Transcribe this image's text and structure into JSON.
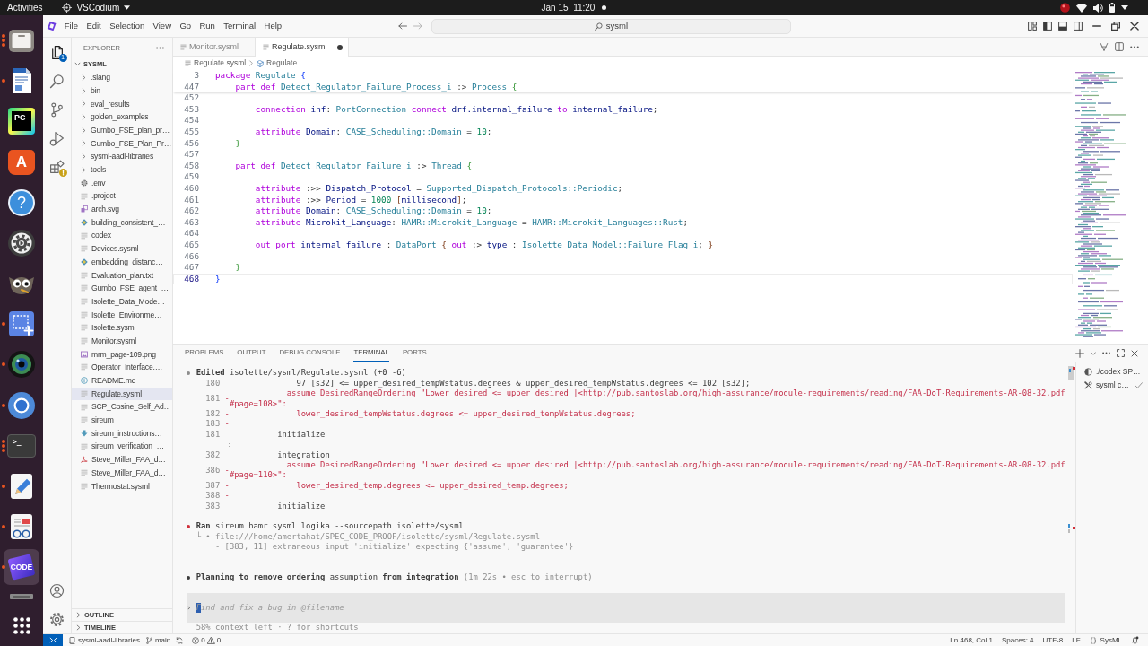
{
  "top_bar": {
    "activities": "Activities",
    "app_menu": "VSCodium",
    "clock": "Jan 15  11:20"
  },
  "dock": [
    {
      "kind": "files",
      "running": true,
      "multiple_windows": true,
      "focused": false
    },
    {
      "kind": "writer",
      "running": true,
      "multiple_windows": false,
      "focused": false
    },
    {
      "kind": "pycharm",
      "label": "PC",
      "running": false,
      "focused": false
    },
    {
      "kind": "store",
      "label": "A",
      "running": false,
      "focused": false
    },
    {
      "kind": "help",
      "label": "?",
      "running": false,
      "focused": false
    },
    {
      "kind": "settings",
      "running": false,
      "focused": false
    },
    {
      "kind": "gimp",
      "running": false,
      "focused": false
    },
    {
      "kind": "screenshot",
      "running": true,
      "multiple_windows": false,
      "focused": false
    },
    {
      "kind": "lens",
      "running": true,
      "multiple_windows": false,
      "focused": false
    },
    {
      "kind": "browser",
      "running": true,
      "multiple_windows": false,
      "focused": false
    },
    {
      "kind": "terminal",
      "label": ">_",
      "running": true,
      "multiple_windows": true,
      "focused": false
    },
    {
      "kind": "editor",
      "running": true,
      "multiple_windows": false,
      "focused": false
    },
    {
      "kind": "viewer",
      "running": true,
      "multiple_windows": false,
      "focused": false
    },
    {
      "kind": "code",
      "label": "CODE",
      "running": true,
      "multiple_windows": false,
      "focused": true
    },
    {
      "kind": "partial",
      "running": false,
      "focused": false
    }
  ],
  "title_bar": {
    "menu": [
      "File",
      "Edit",
      "Selection",
      "View",
      "Go",
      "Run",
      "Terminal",
      "Help"
    ],
    "search": "sysml"
  },
  "activity_bar": {
    "items": [
      {
        "kind": "explorer",
        "selected": true,
        "warning": false,
        "badge": "1"
      },
      {
        "kind": "search",
        "selected": false,
        "warning": false
      },
      {
        "kind": "source_control",
        "selected": false,
        "warning": false
      },
      {
        "kind": "run_debug",
        "selected": false,
        "warning": false
      },
      {
        "kind": "extensions",
        "selected": false,
        "warning": true
      }
    ],
    "bottom": [
      {
        "kind": "account"
      },
      {
        "kind": "manage"
      }
    ]
  },
  "explorer": {
    "title": "EXPLORER",
    "root": {
      "label": "SYSML",
      "expanded": true,
      "folders": [
        {
          "label": ".slang",
          "expanded": false,
          "selected": false
        },
        {
          "label": "bin",
          "expanded": false,
          "selected": false
        },
        {
          "label": "eval_results",
          "expanded": false,
          "selected": false
        },
        {
          "label": "golden_examples",
          "expanded": false,
          "selected": false
        },
        {
          "label": "Gumbo_FSE_plan_pr…",
          "expanded": false,
          "selected": false
        },
        {
          "label": "Gumbo_FSE_Plan_Pr…",
          "expanded": false,
          "selected": false
        },
        {
          "label": "sysml-aadl-libraries",
          "expanded": false,
          "selected": false
        },
        {
          "label": "tools",
          "expanded": false,
          "selected": false
        }
      ],
      "files": [
        {
          "label": ".env",
          "kind": "settings",
          "selected": false
        },
        {
          "label": ".project",
          "kind": "text",
          "selected": false
        },
        {
          "label": "arch.svg",
          "kind": "vector",
          "selected": false
        },
        {
          "label": "building_consistent_…",
          "kind": "script",
          "selected": false
        },
        {
          "label": "codex",
          "kind": "text",
          "selected": false
        },
        {
          "label": "Devices.sysml",
          "kind": "text",
          "selected": false
        },
        {
          "label": "embedding_distanc…",
          "kind": "script",
          "selected": false
        },
        {
          "label": "Evaluation_plan.txt",
          "kind": "text",
          "selected": false
        },
        {
          "label": "Gumbo_FSE_agent_…",
          "kind": "text",
          "selected": false
        },
        {
          "label": "Isolette_Data_Mode…",
          "kind": "text",
          "selected": false
        },
        {
          "label": "Isolette_Environme…",
          "kind": "text",
          "selected": false
        },
        {
          "label": "Isolette.sysml",
          "kind": "text",
          "selected": false
        },
        {
          "label": "Monitor.sysml",
          "kind": "text",
          "selected": false
        },
        {
          "label": "mrm_page-109.png",
          "kind": "image",
          "selected": false
        },
        {
          "label": "Operator_Interface.…",
          "kind": "text",
          "selected": false
        },
        {
          "label": "README.md",
          "kind": "info",
          "selected": false
        },
        {
          "label": "Regulate.sysml",
          "kind": "text",
          "selected": true
        },
        {
          "label": "SCP_Cosine_Self_Ad…",
          "kind": "text",
          "selected": false
        },
        {
          "label": "sireum",
          "kind": "text",
          "selected": false
        },
        {
          "label": "sireum_instructions…",
          "kind": "download",
          "selected": false
        },
        {
          "label": "sireum_verification_…",
          "kind": "text",
          "selected": false
        },
        {
          "label": "Steve_Miller_FAA_d…",
          "kind": "pdf",
          "selected": false
        },
        {
          "label": "Steve_Miller_FAA_d…",
          "kind": "text",
          "selected": false
        },
        {
          "label": "Thermostat.sysml",
          "kind": "text",
          "selected": false
        }
      ]
    },
    "sections": [
      {
        "label": "OUTLINE",
        "expanded": false
      },
      {
        "label": "TIMELINE",
        "expanded": false
      }
    ]
  },
  "editor": {
    "tabs": [
      {
        "label": "Monitor.sysml",
        "selected": false,
        "modified": false
      },
      {
        "label": "Regulate.sysml",
        "selected": true,
        "modified": true
      }
    ],
    "breadcrumb": [
      {
        "label": "Regulate.sysml",
        "kind": "file"
      },
      {
        "label": "Regulate",
        "kind": "package"
      }
    ],
    "sticky_lines": [
      {
        "number": "3",
        "tokens": [
          {
            "text": "package ",
            "kind": "keyword"
          },
          {
            "text": "Regulate ",
            "kind": "type"
          },
          {
            "text": "{",
            "kind": "bracket1"
          }
        ]
      },
      {
        "number": "447",
        "tokens": [
          {
            "text": "    part def ",
            "kind": "keyword"
          },
          {
            "text": "Detect_Regulator_Failure_Process_i ",
            "kind": "type"
          },
          {
            "text": ":> ",
            "kind": "operator"
          },
          {
            "text": "Process ",
            "kind": "type"
          },
          {
            "text": "{",
            "kind": "bracket2"
          }
        ]
      }
    ],
    "lines": [
      {
        "number": "452",
        "current": false
      },
      {
        "number": "453",
        "current": false,
        "tokens": [
          {
            "text": "        connection ",
            "kind": "keyword"
          },
          {
            "text": "inf",
            "kind": "name"
          },
          {
            "text": ": ",
            "kind": "operator"
          },
          {
            "text": "PortConnection ",
            "kind": "type"
          },
          {
            "text": "connect ",
            "kind": "keyword"
          },
          {
            "text": "drf.internal_failure ",
            "kind": "name"
          },
          {
            "text": "to ",
            "kind": "keyword"
          },
          {
            "text": "internal_failure",
            "kind": "name"
          },
          {
            "text": ";",
            "kind": "operator"
          }
        ]
      },
      {
        "number": "454",
        "current": false
      },
      {
        "number": "455",
        "current": false,
        "tokens": [
          {
            "text": "        attribute ",
            "kind": "keyword"
          },
          {
            "text": "Domain",
            "kind": "name"
          },
          {
            "text": ": ",
            "kind": "operator"
          },
          {
            "text": "CASE_Scheduling::Domain ",
            "kind": "type"
          },
          {
            "text": "= ",
            "kind": "operator"
          },
          {
            "text": "10",
            "kind": "number"
          },
          {
            "text": ";",
            "kind": "operator"
          }
        ]
      },
      {
        "number": "456",
        "current": false,
        "tokens": [
          {
            "text": "    }",
            "kind": "bracket2"
          }
        ]
      },
      {
        "number": "457",
        "current": false
      },
      {
        "number": "458",
        "current": false,
        "tokens": [
          {
            "text": "    part def ",
            "kind": "keyword"
          },
          {
            "text": "Detect_Regulator_Failure_i ",
            "kind": "type"
          },
          {
            "text": ":> ",
            "kind": "operator"
          },
          {
            "text": "Thread ",
            "kind": "type"
          },
          {
            "text": "{",
            "kind": "bracket2"
          }
        ]
      },
      {
        "number": "459",
        "current": false
      },
      {
        "number": "460",
        "current": false,
        "tokens": [
          {
            "text": "        attribute ",
            "kind": "keyword"
          },
          {
            "text": ":>> ",
            "kind": "operator"
          },
          {
            "text": "Dispatch_Protocol ",
            "kind": "name"
          },
          {
            "text": "= ",
            "kind": "operator"
          },
          {
            "text": "Supported_Dispatch_Protocols::Periodic",
            "kind": "type"
          },
          {
            "text": ";",
            "kind": "operator"
          }
        ]
      },
      {
        "number": "461",
        "current": false,
        "tokens": [
          {
            "text": "        attribute ",
            "kind": "keyword"
          },
          {
            "text": ":>> ",
            "kind": "operator"
          },
          {
            "text": "Period ",
            "kind": "name"
          },
          {
            "text": "= ",
            "kind": "operator"
          },
          {
            "text": "1000 ",
            "kind": "number"
          },
          {
            "text": "[",
            "kind": "bracket3"
          },
          {
            "text": "millisecond",
            "kind": "name"
          },
          {
            "text": "]",
            "kind": "bracket3"
          },
          {
            "text": ";",
            "kind": "operator"
          }
        ]
      },
      {
        "number": "462",
        "current": false,
        "tokens": [
          {
            "text": "        attribute ",
            "kind": "keyword"
          },
          {
            "text": "Domain",
            "kind": "name"
          },
          {
            "text": ": ",
            "kind": "operator"
          },
          {
            "text": "CASE_Scheduling::Domain ",
            "kind": "type"
          },
          {
            "text": "= ",
            "kind": "operator"
          },
          {
            "text": "10",
            "kind": "number"
          },
          {
            "text": ";",
            "kind": "operator"
          }
        ]
      },
      {
        "number": "463",
        "current": false,
        "tokens": [
          {
            "text": "        attribute ",
            "kind": "keyword"
          },
          {
            "text": "Microkit_Language",
            "kind": "name"
          },
          {
            "text": ": ",
            "kind": "operator"
          },
          {
            "text": "HAMR::Microkit_Language ",
            "kind": "type"
          },
          {
            "text": "= ",
            "kind": "operator"
          },
          {
            "text": "HAMR::Microkit_Languages::Rust",
            "kind": "type"
          },
          {
            "text": ";",
            "kind": "operator"
          }
        ]
      },
      {
        "number": "464",
        "current": false
      },
      {
        "number": "465",
        "current": false,
        "tokens": [
          {
            "text": "        out port ",
            "kind": "keyword"
          },
          {
            "text": "internal_failure ",
            "kind": "name"
          },
          {
            "text": ": ",
            "kind": "operator"
          },
          {
            "text": "DataPort ",
            "kind": "type"
          },
          {
            "text": "{ ",
            "kind": "bracket3"
          },
          {
            "text": "out ",
            "kind": "keyword"
          },
          {
            "text": ":> ",
            "kind": "operator"
          },
          {
            "text": "type ",
            "kind": "name"
          },
          {
            "text": ": ",
            "kind": "operator"
          },
          {
            "text": "Isolette_Data_Model::Failure_Flag_i",
            "kind": "type"
          },
          {
            "text": "; ",
            "kind": "operator"
          },
          {
            "text": "}",
            "kind": "bracket3"
          }
        ]
      },
      {
        "number": "466",
        "current": false
      },
      {
        "number": "467",
        "current": false,
        "tokens": [
          {
            "text": "    }",
            "kind": "bracket2"
          }
        ]
      },
      {
        "number": "468",
        "current": true,
        "tokens": [
          {
            "text": "}",
            "kind": "bracket1"
          }
        ]
      }
    ]
  },
  "panel": {
    "tabs": [
      {
        "label": "PROBLEMS",
        "selected": false
      },
      {
        "label": "OUTPUT",
        "selected": false
      },
      {
        "label": "DEBUG CONSOLE",
        "selected": false
      },
      {
        "label": "TERMINAL",
        "selected": true
      },
      {
        "label": "PORTS",
        "selected": false
      }
    ],
    "terminal": {
      "entries": [
        {
          "kind": "heading",
          "color": "#8d8d8d",
          "text": "**Edited** isolette/sysml/Regulate.sysml (+0 -6)"
        },
        {
          "kind": "context",
          "number": "180",
          "text": "              97 [s32] <= upper_desired_tempWstatus.degrees & upper_desired_tempWstatus.degrees <= 102 [s32];"
        },
        {
          "kind": "removed",
          "number": "181",
          "marker": "-",
          "text": "            assume DesiredRangeOrdering \"Lower desired <= upper desired |<http://pub.santoslab.org/high-assurance/module-requirements/reading/FAA-DoT-Requirements-AR-08-32.pdf#page=108>\":"
        },
        {
          "kind": "removed",
          "number": "182",
          "marker": "-",
          "text": "              lower_desired_tempWstatus.degrees <= upper_desired_tempWstatus.degrees;"
        },
        {
          "kind": "removed",
          "number": "183",
          "marker": "-"
        },
        {
          "kind": "context",
          "number": "181",
          "text": "          initialize"
        },
        {
          "kind": "gap",
          "text": "⋮"
        },
        {
          "kind": "context",
          "number": "382",
          "text": "          integration"
        },
        {
          "kind": "removed",
          "number": "386",
          "marker": "-",
          "text": "            assume DesiredRangeOrdering \"Lower desired <= upper desired |<http://pub.santoslab.org/high-assurance/module-requirements/reading/FAA-DoT-Requirements-AR-08-32.pdf#page=110>\":"
        },
        {
          "kind": "removed",
          "number": "387",
          "marker": "-",
          "text": "              lower_desired_temp.degrees <= upper_desired_temp.degrees;"
        },
        {
          "kind": "removed",
          "number": "388",
          "marker": "-"
        },
        {
          "kind": "context",
          "number": "383",
          "text": "          initialize"
        },
        {
          "kind": "heading",
          "color": "#d0303a",
          "text": "**Ran** sireum hamr sysml logika --sourcepath isolette/sysml"
        },
        {
          "kind": "output",
          "text": "  └ • file:///home/amertahat/SPEC_CODE_PROOF/isolette/sysml/Regulate.sysml"
        },
        {
          "kind": "output",
          "text": "      - [383, 11] extraneous input 'initialize' expecting {'assume', 'guarantee'}"
        },
        {
          "kind": "status",
          "color": "#3b3b3b",
          "text": "**Planning to remove ordering** assumption **from integration**",
          "detail": "(1m 22s • esc to interrupt)"
        }
      ],
      "input": {
        "prompt": "›",
        "placeholder": "Find and fix a bug in @filename"
      },
      "footer": "58% context left · ? for shortcuts"
    },
    "sessions": [
      {
        "label": "./codex SP…",
        "kind": "agent",
        "completed": false
      },
      {
        "label": "sysml c…",
        "kind": "task",
        "completed": true
      }
    ]
  },
  "status_bar": {
    "repo": "sysml-aadl-libraries",
    "branch": "main",
    "errors": "0",
    "warnings": "0",
    "position": "Ln 468, Col 1",
    "indent": "Spaces: 4",
    "encoding": "UTF-8",
    "eol": "LF",
    "language": "SysML"
  }
}
